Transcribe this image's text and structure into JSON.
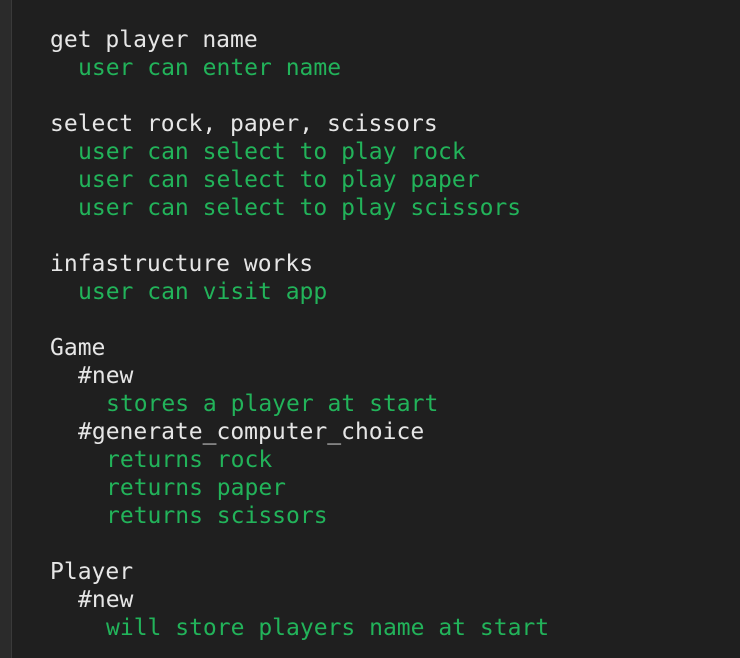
{
  "colors": {
    "background": "#1f1f1f",
    "group_text": "#e6e6e6",
    "passing_text": "#22b35a"
  },
  "output": {
    "lines": [
      {
        "text": "get player name",
        "kind": "group",
        "indent": 0
      },
      {
        "text": "user can enter name",
        "kind": "pass",
        "indent": 1
      },
      {
        "text": "",
        "kind": "blank",
        "indent": 0
      },
      {
        "text": "select rock, paper, scissors",
        "kind": "group",
        "indent": 0
      },
      {
        "text": "user can select to play rock",
        "kind": "pass",
        "indent": 1
      },
      {
        "text": "user can select to play paper",
        "kind": "pass",
        "indent": 1
      },
      {
        "text": "user can select to play scissors",
        "kind": "pass",
        "indent": 1
      },
      {
        "text": "",
        "kind": "blank",
        "indent": 0
      },
      {
        "text": "infastructure works",
        "kind": "group",
        "indent": 0
      },
      {
        "text": "user can visit app",
        "kind": "pass",
        "indent": 1
      },
      {
        "text": "",
        "kind": "blank",
        "indent": 0
      },
      {
        "text": "Game",
        "kind": "group",
        "indent": 0
      },
      {
        "text": "#new",
        "kind": "group",
        "indent": 1
      },
      {
        "text": "stores a player at start",
        "kind": "pass",
        "indent": 2
      },
      {
        "text": "#generate_computer_choice",
        "kind": "group",
        "indent": 1
      },
      {
        "text": "returns rock",
        "kind": "pass",
        "indent": 2
      },
      {
        "text": "returns paper",
        "kind": "pass",
        "indent": 2
      },
      {
        "text": "returns scissors",
        "kind": "pass",
        "indent": 2
      },
      {
        "text": "",
        "kind": "blank",
        "indent": 0
      },
      {
        "text": "Player",
        "kind": "group",
        "indent": 0
      },
      {
        "text": "#new",
        "kind": "group",
        "indent": 1
      },
      {
        "text": "will store players name at start",
        "kind": "pass",
        "indent": 2
      }
    ]
  }
}
